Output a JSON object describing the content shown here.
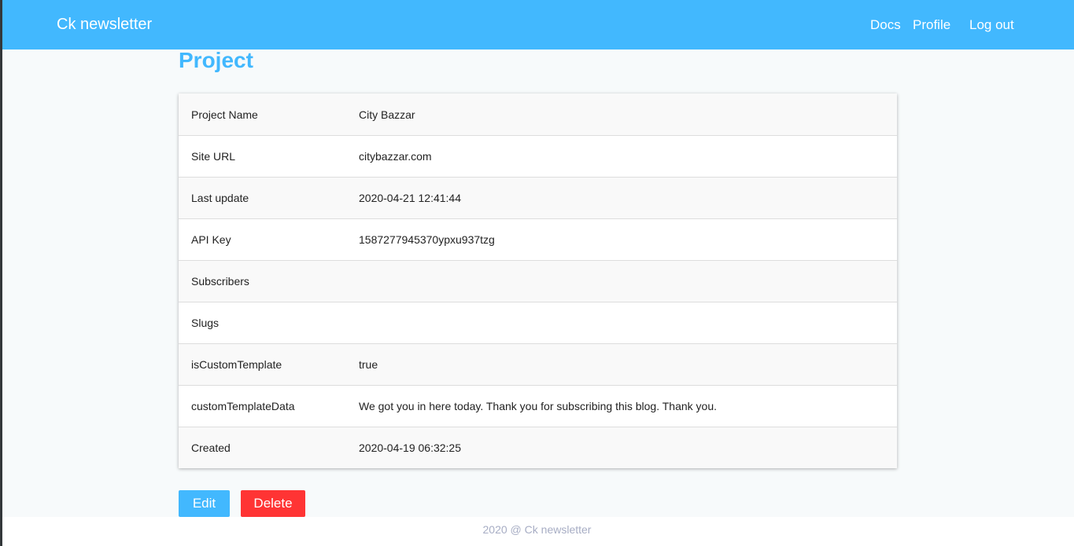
{
  "header": {
    "brand": "Ck newsletter",
    "links": [
      "Docs",
      "Profile",
      "Log out"
    ]
  },
  "page_title": "Project",
  "details": [
    {
      "label": "Project Name",
      "value": "City Bazzar"
    },
    {
      "label": "Site URL",
      "value": "citybazzar.com"
    },
    {
      "label": "Last update",
      "value": "2020-04-21 12:41:44"
    },
    {
      "label": "API Key",
      "value": "1587277945370ypxu937tzg"
    },
    {
      "label": "Subscribers",
      "value": ""
    },
    {
      "label": "Slugs",
      "value": ""
    },
    {
      "label": "isCustomTemplate",
      "value": "true"
    },
    {
      "label": "customTemplateData",
      "value": "We got you in here today. Thank you for subscribing this blog. Thank you."
    },
    {
      "label": "Created",
      "value": "2020-04-19 06:32:25"
    }
  ],
  "actions": {
    "edit": "Edit",
    "delete": "Delete"
  },
  "footer": "2020 @ Ck newsletter",
  "colors": {
    "primary": "#42b8fe",
    "danger": "#ff3434"
  }
}
